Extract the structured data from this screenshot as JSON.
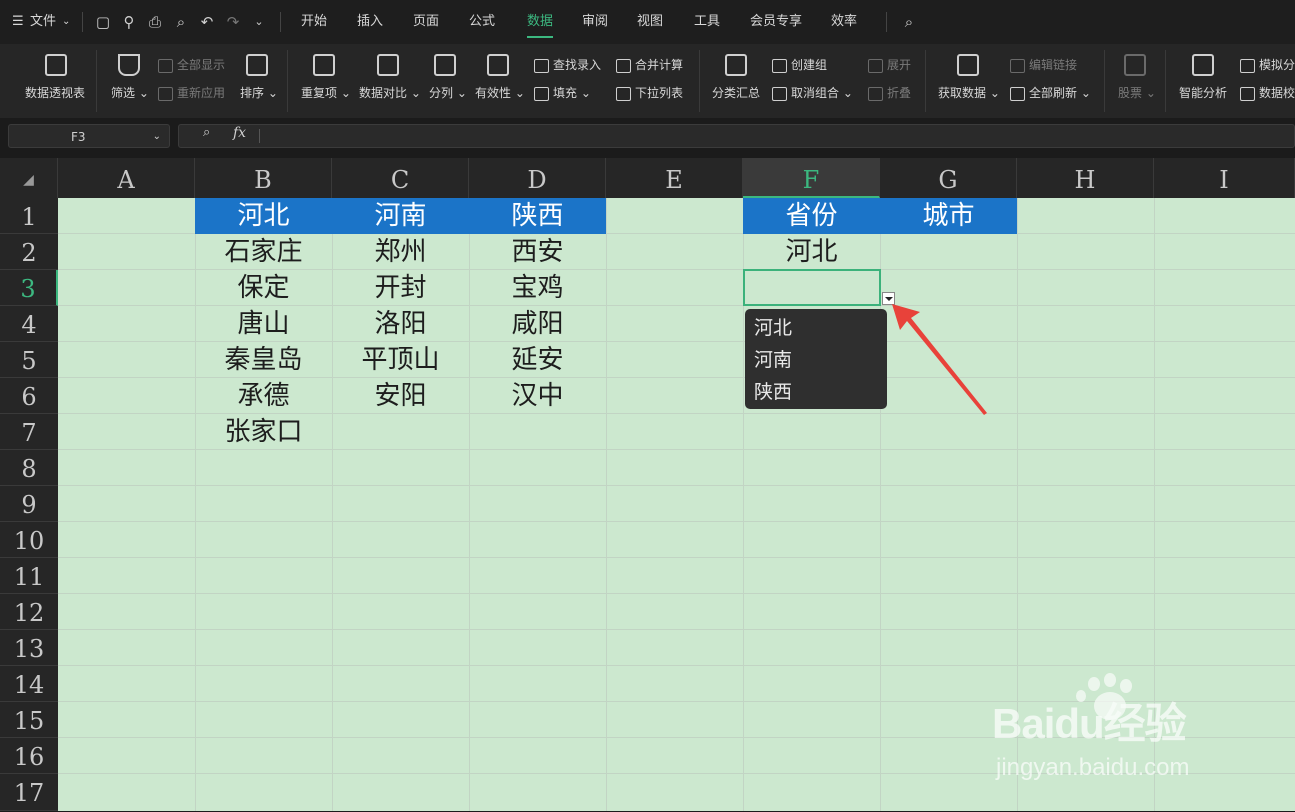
{
  "menubar": {
    "hamburger": "☰",
    "file_label": "文件",
    "tabs": [
      "开始",
      "插入",
      "页面",
      "公式",
      "数据",
      "审阅",
      "视图",
      "工具",
      "会员专享",
      "效率"
    ],
    "active_tab": "数据"
  },
  "ribbon": {
    "pivot": "数据透视表",
    "filter": "筛选",
    "show_all": "全部显示",
    "reapply": "重新应用",
    "sort": "排序",
    "duplicates": "重复项",
    "compare": "数据对比",
    "split": "分列",
    "validity": "有效性",
    "find_entry": "查找录入",
    "fill": "填充",
    "consolidate": "合并计算",
    "dropdown_list": "下拉列表",
    "subtotal": "分类汇总",
    "create_group": "创建组",
    "ungroup": "取消组合",
    "expand": "展开",
    "collapse": "折叠",
    "get_data": "获取数据",
    "edit_links": "编辑链接",
    "refresh_all": "全部刷新",
    "stocks": "股票",
    "smart_analysis": "智能分析",
    "what_if": "模拟分",
    "data_check": "数据校"
  },
  "formula_bar": {
    "cell_ref": "F3",
    "fx": "fx",
    "formula": ""
  },
  "grid": {
    "columns": [
      "A",
      "B",
      "C",
      "D",
      "E",
      "F",
      "G",
      "H",
      "I"
    ],
    "selected_column": "F",
    "rows": [
      "1",
      "2",
      "3",
      "4",
      "5",
      "6",
      "7",
      "8",
      "9",
      "10",
      "11",
      "12",
      "13",
      "14",
      "15",
      "16",
      "17"
    ],
    "selected_row": "3",
    "header_row": {
      "B": "河北",
      "C": "河南",
      "D": "陕西",
      "F": "省份",
      "G": "城市"
    },
    "col_B": [
      "石家庄",
      "保定",
      "唐山",
      "秦皇岛",
      "承德",
      "张家口"
    ],
    "col_C": [
      "郑州",
      "开封",
      "洛阳",
      "平顶山",
      "安阳"
    ],
    "col_D": [
      "西安",
      "宝鸡",
      "咸阳",
      "延安",
      "汉中"
    ],
    "F2": "河北",
    "selected_cell": "F3"
  },
  "dropdown": {
    "options": [
      "河北",
      "河南",
      "陕西"
    ]
  },
  "annotation": {
    "arrow_color": "#e8423a"
  },
  "watermark": {
    "logo": "Baidu经验",
    "url": "jingyan.baidu.com"
  }
}
